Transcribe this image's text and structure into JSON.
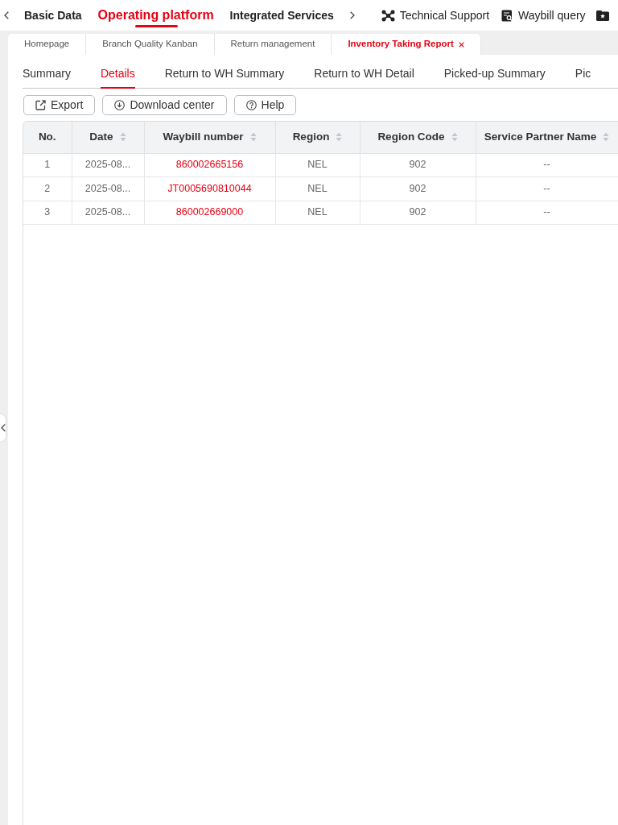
{
  "top_nav": {
    "menu": [
      {
        "label": "Basic Data",
        "selected": false
      },
      {
        "label": "Operating platform",
        "selected": true
      },
      {
        "label": "Integrated Services",
        "selected": false
      }
    ],
    "links": [
      {
        "label": "Technical Support"
      },
      {
        "label": "Waybill query"
      }
    ]
  },
  "page_tabs": [
    {
      "label": "Homepage",
      "selected": false
    },
    {
      "label": "Branch Quality Kanban",
      "selected": false
    },
    {
      "label": "Return management",
      "selected": false
    },
    {
      "label": "Inventory Taking Report",
      "selected": true
    }
  ],
  "sub_tabs": [
    {
      "label": "Summary",
      "selected": false
    },
    {
      "label": "Details",
      "selected": true
    },
    {
      "label": "Return to WH Summary",
      "selected": false
    },
    {
      "label": "Return to WH Detail",
      "selected": false
    },
    {
      "label": "Picked-up Summary",
      "selected": false
    },
    {
      "label": "Pic",
      "selected": false
    }
  ],
  "toolbar": [
    {
      "label": "Export"
    },
    {
      "label": "Download center"
    },
    {
      "label": "Help"
    }
  ],
  "table": {
    "columns": [
      {
        "label": "No.",
        "sortable": false,
        "kind": "text"
      },
      {
        "label": "Date",
        "sortable": true,
        "kind": "text"
      },
      {
        "label": "Waybill number",
        "sortable": true,
        "kind": "link"
      },
      {
        "label": "Region",
        "sortable": true,
        "kind": "text"
      },
      {
        "label": "Region Code",
        "sortable": true,
        "kind": "text"
      },
      {
        "label": "Service Partner Name",
        "sortable": true,
        "kind": "text"
      }
    ],
    "rows": [
      [
        "1",
        "2025-08...",
        "860002665156",
        "NEL",
        "902",
        "--"
      ],
      [
        "2",
        "2025-08...",
        "JT0005690810044",
        "NEL",
        "902",
        "--"
      ],
      [
        "3",
        "2025-08...",
        "860002669000",
        "NEL",
        "902",
        "--"
      ]
    ]
  }
}
